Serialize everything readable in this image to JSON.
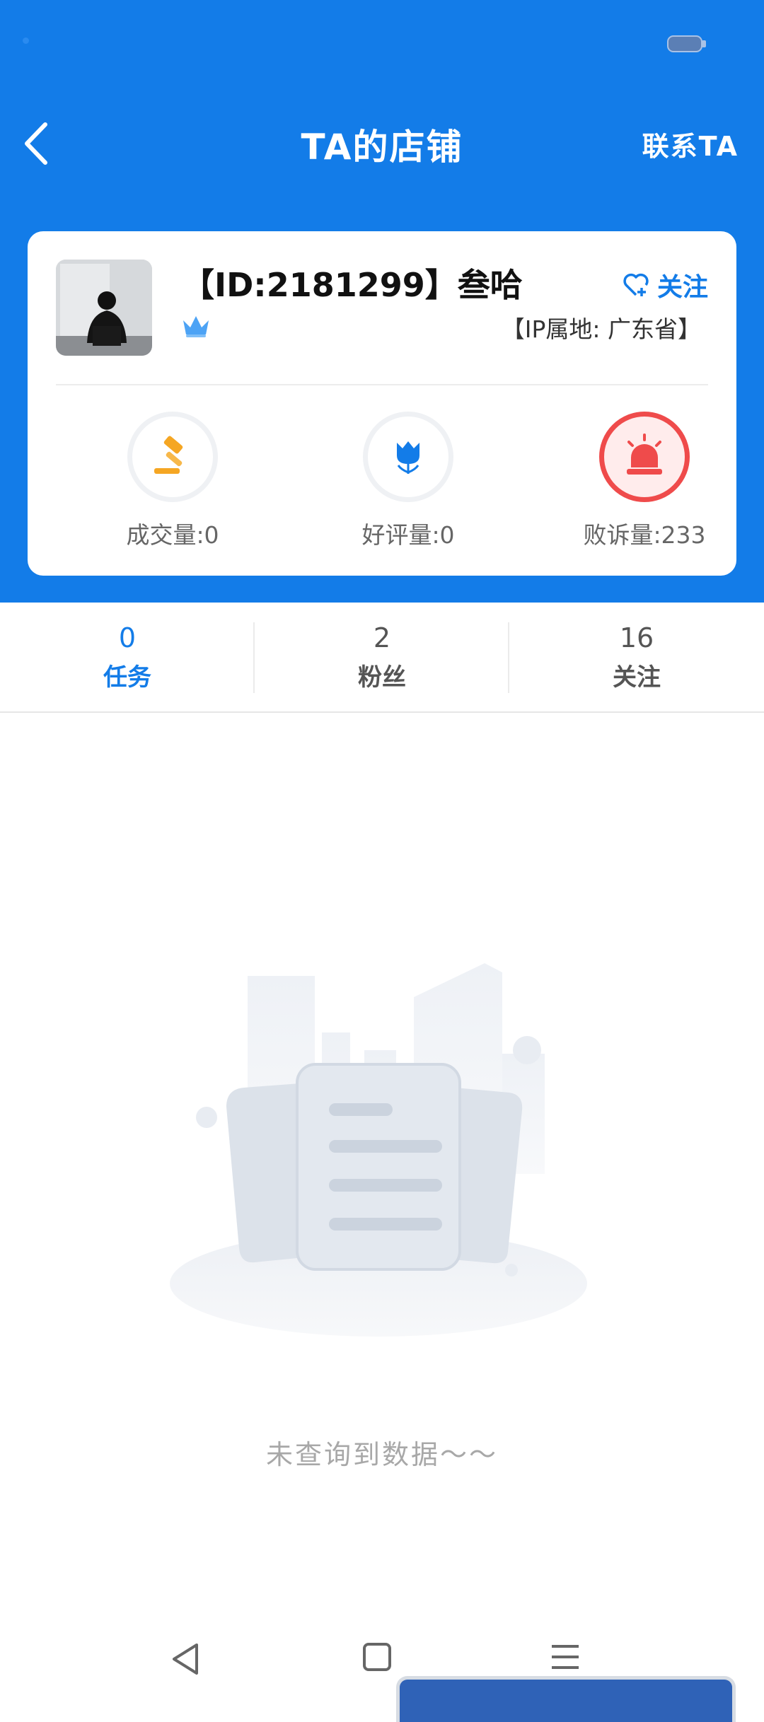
{
  "header": {
    "title": "TA的店铺",
    "contact_label": "联系TA"
  },
  "shop": {
    "name": "【ID:2181299】叁哈",
    "follow_label": "关注",
    "ip_location": "【IP属地: 广东省】"
  },
  "metrics": [
    {
      "label": "成交量:0",
      "icon": "gavel-icon",
      "color": "#F5A623"
    },
    {
      "label": "好评量:0",
      "icon": "tulip-icon",
      "color": "#137CE8"
    },
    {
      "label": "败诉量:233",
      "icon": "alarm-icon",
      "color": "#EF4B4B"
    }
  ],
  "stats": [
    {
      "value": "0",
      "label": "任务"
    },
    {
      "value": "2",
      "label": "粉丝"
    },
    {
      "value": "16",
      "label": "关注"
    }
  ],
  "empty_state": {
    "message": "未查询到数据～～"
  },
  "colors": {
    "primary": "#137CE8",
    "alert": "#EF4B4B",
    "gold": "#F5A623"
  }
}
